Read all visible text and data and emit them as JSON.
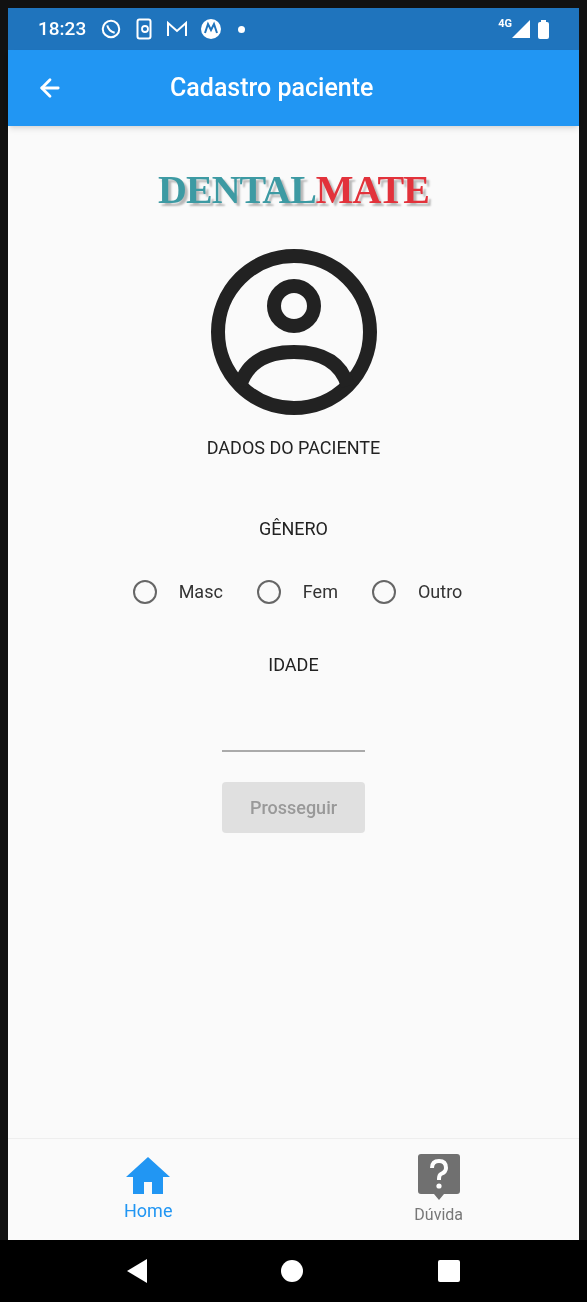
{
  "status_bar": {
    "time": "18:23",
    "network": "4G"
  },
  "app_bar": {
    "title": "Cadastro paciente"
  },
  "logo": [
    {
      "text": "DENTAL",
      "color": "#3d9aa3"
    },
    {
      "text": "MATE",
      "color": "#e2323b"
    }
  ],
  "section_title": "DADOS DO PACIENTE",
  "gender": {
    "label": "GÊNERO",
    "options": [
      {
        "label": "Masc",
        "selected": false
      },
      {
        "label": "Fem",
        "selected": false
      },
      {
        "label": "Outro",
        "selected": false
      }
    ]
  },
  "age": {
    "label": "IDADE"
  },
  "continue_button": {
    "label": "Prosseguir",
    "disabled": true
  },
  "bottom_nav": [
    {
      "label": "Home",
      "kind": "home",
      "selected": true
    },
    {
      "label": "Dúvida",
      "kind": "help",
      "selected": false
    }
  ]
}
